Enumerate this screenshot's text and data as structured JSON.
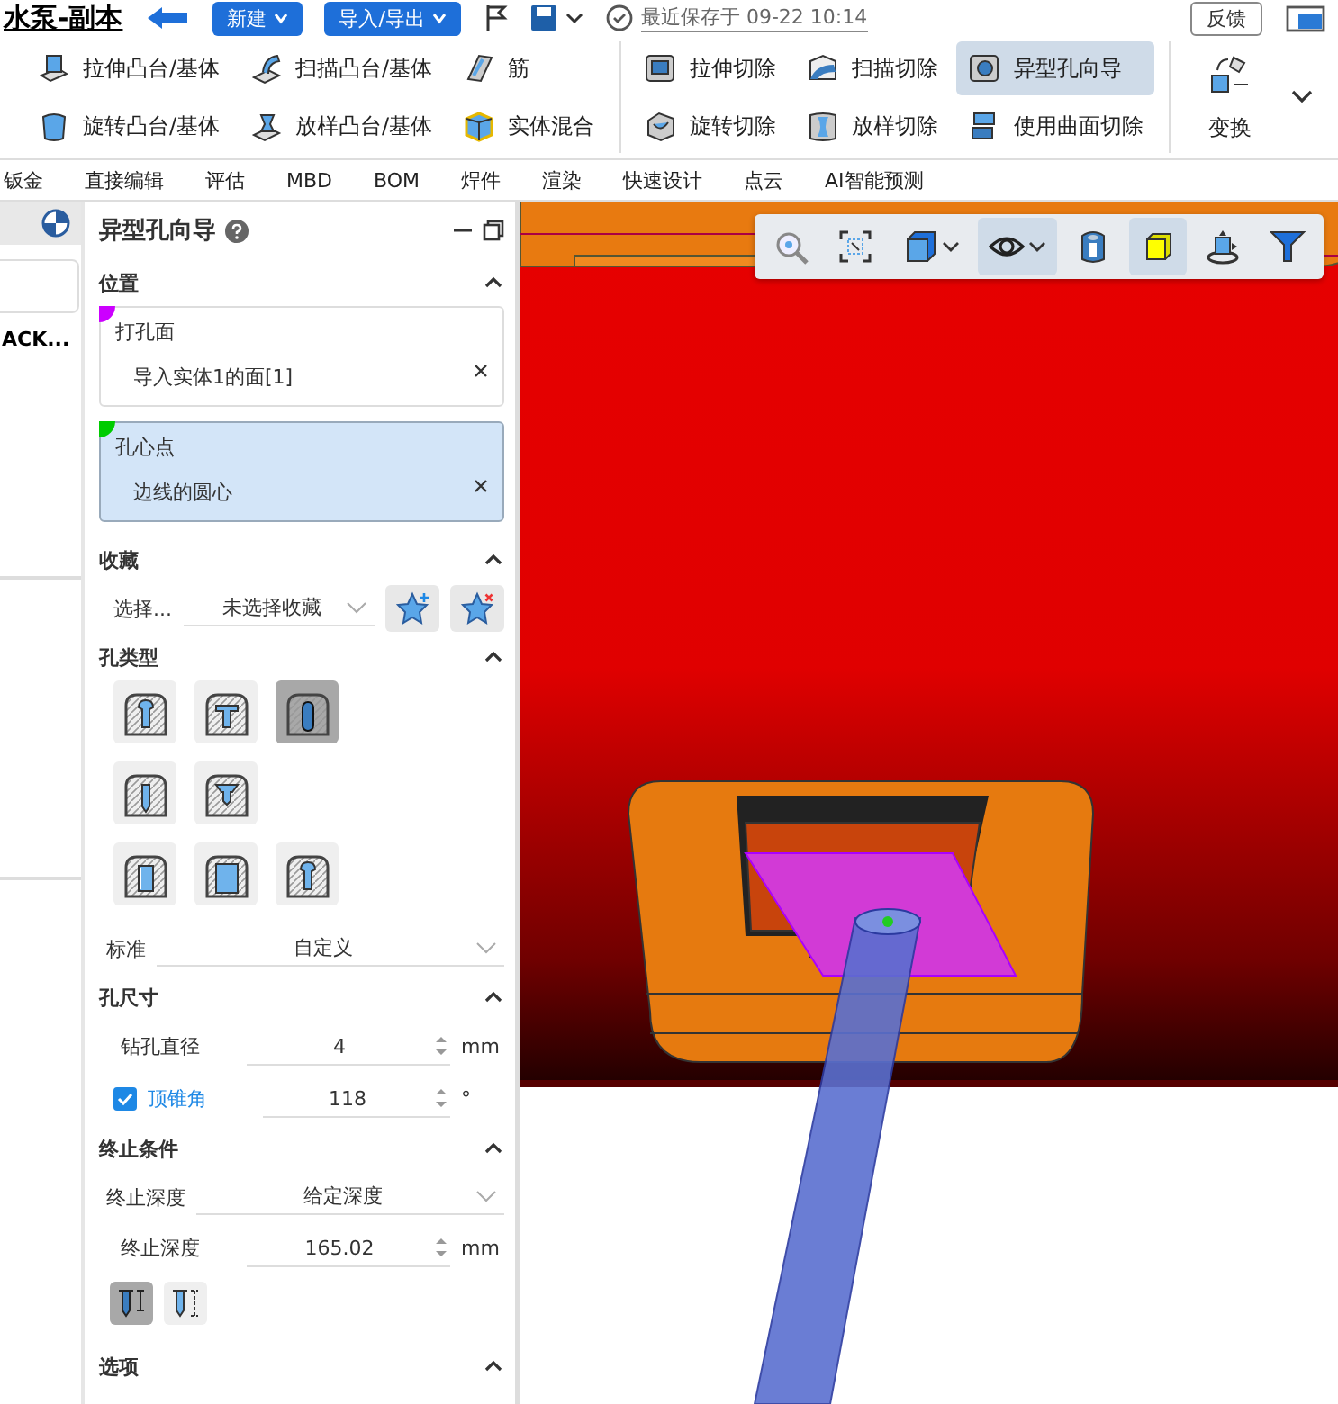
{
  "title": "水泵-副本",
  "top_buttons": [
    {
      "label": "新建"
    },
    {
      "label": "导入/导出"
    }
  ],
  "save_status": "最近保存于 09-22 10:14",
  "feedback_button": "反馈",
  "ribbon": {
    "groups": [
      {
        "items": [
          {
            "label": "拉伸凸台/基体",
            "selected": false
          },
          {
            "label": "旋转凸台/基体",
            "selected": false
          },
          {
            "label": "扫描凸台/基体",
            "selected": false
          },
          {
            "label": "放样凸台/基体",
            "selected": false
          },
          {
            "label": "筋",
            "selected": false
          },
          {
            "label": "实体混合",
            "selected": false
          }
        ]
      },
      {
        "items": [
          {
            "label": "拉伸切除",
            "selected": false
          },
          {
            "label": "旋转切除",
            "selected": false
          },
          {
            "label": "扫描切除",
            "selected": false
          },
          {
            "label": "放样切除",
            "selected": false
          },
          {
            "label": "异型孔向导",
            "selected": true
          },
          {
            "label": "使用曲面切除",
            "selected": false
          }
        ]
      }
    ],
    "large_button": "变换"
  },
  "tabs": [
    "钣金",
    "直接编辑",
    "评估",
    "MBD",
    "BOM",
    "焊件",
    "渲染",
    "快速设计",
    "点云",
    "AI智能预测"
  ],
  "feature_tree": {
    "item": "ACK..."
  },
  "hole_wizard": {
    "title": "异型孔向导",
    "sections": [
      {
        "title": "位置",
        "expanded": true,
        "boxes": [
          {
            "label": "打孔面",
            "value": "导入实体1的面[1]",
            "color": "#cc00ff",
            "selected": false
          },
          {
            "label": "孔心点",
            "value": "边线的圆心",
            "color": "#00cc00",
            "selected": true
          }
        ]
      },
      {
        "title": "收藏",
        "expanded": true,
        "favorites": {
          "label": "选择...",
          "value": "未选择收藏"
        }
      },
      {
        "title": "孔类型",
        "expanded": true,
        "hole_types": [
          [
            {
              "selected": false
            },
            {
              "selected": false
            },
            {
              "selected": true
            }
          ],
          [
            {
              "selected": false
            },
            {
              "selected": false
            }
          ],
          [
            {
              "selected": false
            },
            {
              "selected": false
            },
            {
              "selected": false
            }
          ]
        ],
        "fields": [
          {
            "kind": "dropdown",
            "label": "标准",
            "value": "自定义"
          }
        ]
      },
      {
        "title": "孔尺寸",
        "expanded": true,
        "fields": [
          {
            "kind": "spin",
            "label": "钻孔直径",
            "value": "4",
            "unit": "mm"
          },
          {
            "kind": "check-spin",
            "label": "顶锥角",
            "checked": true,
            "value": "118",
            "unit": "°"
          }
        ]
      },
      {
        "title": "终止条件",
        "expanded": true,
        "fields": [
          {
            "kind": "dropdown",
            "label": "终止深度",
            "value": "给定深度"
          },
          {
            "kind": "spin",
            "label": "终止深度",
            "value": "165.02",
            "unit": "mm"
          }
        ],
        "end_types": [
          {
            "selected": true
          },
          {
            "selected": false
          }
        ]
      },
      {
        "title": "选项",
        "expanded": true
      }
    ]
  },
  "view_toolbar": {
    "items": [
      {
        "kind": "zoom",
        "selected": false,
        "dropdown": false
      },
      {
        "kind": "box-select",
        "selected": false,
        "dropdown": false
      },
      {
        "kind": "cube",
        "selected": false,
        "dropdown": true
      },
      {
        "kind": "eye",
        "selected": true,
        "dropdown": true
      },
      {
        "kind": "section",
        "selected": false,
        "dropdown": false
      },
      {
        "kind": "face",
        "selected": true,
        "dropdown": false
      },
      {
        "kind": "rotate",
        "selected": false,
        "dropdown": false
      },
      {
        "kind": "filter",
        "selected": false,
        "dropdown": false
      }
    ]
  }
}
